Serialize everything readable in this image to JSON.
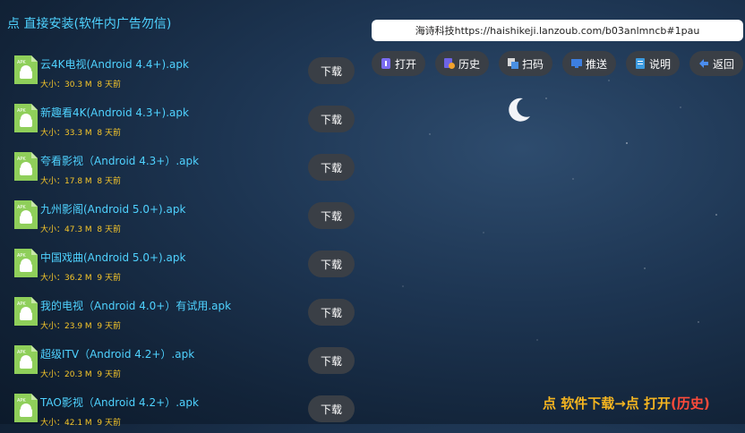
{
  "header": {
    "title": "点 直接安装(软件内广告勿信)"
  },
  "url_bar": {
    "text": "海诗科技https://haishikeji.lanzoub.com/b03anlmncb#1pau"
  },
  "toolbar": [
    {
      "label": "打开",
      "icon": "open-icon"
    },
    {
      "label": "历史",
      "icon": "history-icon"
    },
    {
      "label": "扫码",
      "icon": "scan-icon"
    },
    {
      "label": "推送",
      "icon": "push-icon"
    },
    {
      "label": "说明",
      "icon": "info-icon"
    },
    {
      "label": "返回",
      "icon": "back-icon"
    }
  ],
  "files": [
    {
      "name": "云4K电视(Android 4.4+).apk",
      "size": "大小：30.3 M",
      "age": "8 天前",
      "button": "下载"
    },
    {
      "name": "新趣看4K(Android 4.3+).apk",
      "size": "大小：33.3 M",
      "age": "8 天前",
      "button": "下载"
    },
    {
      "name": "夸看影视（Android 4.3+）.apk",
      "size": "大小：17.8 M",
      "age": "8 天前",
      "button": "下载"
    },
    {
      "name": "九州影阁(Android 5.0+).apk",
      "size": "大小：47.3 M",
      "age": "8 天前",
      "button": "下载"
    },
    {
      "name": "中国戏曲(Android 5.0+).apk",
      "size": "大小：36.2 M",
      "age": "9 天前",
      "button": "下载"
    },
    {
      "name": "我的电视（Android 4.0+）有试用.apk",
      "size": "大小：23.9 M",
      "age": "9 天前",
      "button": "下载"
    },
    {
      "name": "超级ITV（Android 4.2+）.apk",
      "size": "大小：20.3 M",
      "age": "9 天前",
      "button": "下载"
    },
    {
      "name": "TAO影视（Android 4.2+）.apk",
      "size": "大小：42.1 M",
      "age": "9 天前",
      "button": "下载"
    }
  ],
  "footer_hint": {
    "main": "点 软件下载→点 打开",
    "history": "(历史)"
  },
  "colors": {
    "accent": "#4fd2ff",
    "meta": "#f6c62a",
    "hint": "#f5b520",
    "button_bg": "#3a3f46"
  }
}
